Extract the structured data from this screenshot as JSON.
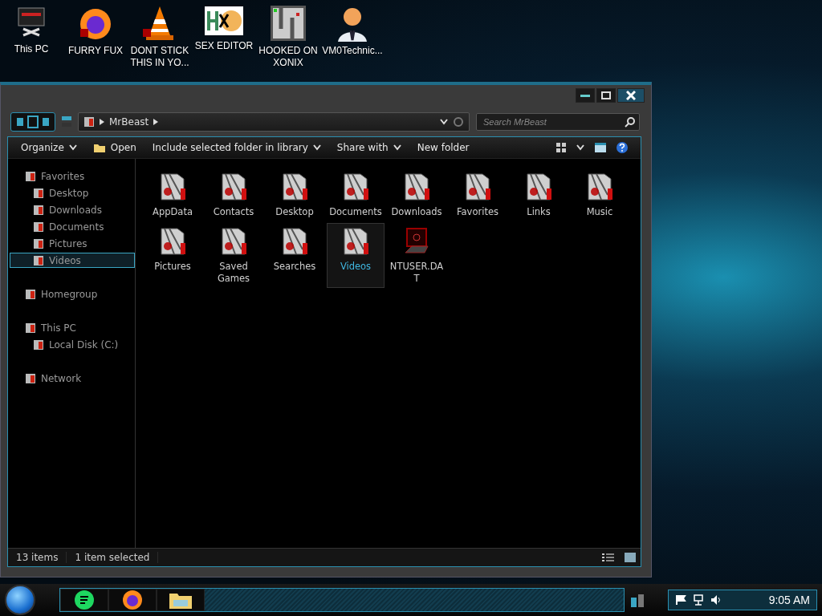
{
  "desktop_icons": [
    {
      "label": "This PC",
      "kind": "pc"
    },
    {
      "label": "FURRY FUX",
      "kind": "browser"
    },
    {
      "label": "DONT STICK THIS IN YO...",
      "kind": "cone"
    },
    {
      "label": "SEX EDITOR",
      "kind": "hex"
    },
    {
      "label": "HOOKED ON XONIX",
      "kind": "game"
    },
    {
      "label": "VM0Technic...",
      "kind": "person"
    }
  ],
  "window": {
    "address": {
      "segments": [
        "MrBeast"
      ]
    },
    "search": {
      "placeholder": "Search MrBeast"
    },
    "commands": [
      {
        "label": "Organize",
        "kind": "menu"
      },
      {
        "label": "Open",
        "kind": "open"
      },
      {
        "label": "Include selected folder in library",
        "kind": "menu"
      },
      {
        "label": "Share with",
        "kind": "menu"
      },
      {
        "label": "New folder",
        "kind": "plain"
      }
    ],
    "nav_pane": [
      {
        "label": "Favorites",
        "selected": false,
        "children": [
          {
            "label": "Desktop",
            "selected": false
          },
          {
            "label": "Downloads",
            "selected": false
          },
          {
            "label": "Documents",
            "selected": false
          },
          {
            "label": "Pictures",
            "selected": false
          },
          {
            "label": "Videos",
            "selected": true
          }
        ]
      },
      {
        "label": "Homegroup",
        "selected": false
      },
      {
        "label": "This PC",
        "selected": false,
        "children": [
          {
            "label": "Local Disk (C:)",
            "selected": false
          }
        ]
      },
      {
        "label": "Network",
        "selected": false
      }
    ],
    "items": [
      {
        "label": "AppData",
        "kind": "folder",
        "selected": false
      },
      {
        "label": "Contacts",
        "kind": "folder",
        "selected": false
      },
      {
        "label": "Desktop",
        "kind": "folder",
        "selected": false
      },
      {
        "label": "Documents",
        "kind": "folder",
        "selected": false
      },
      {
        "label": "Downloads",
        "kind": "folder",
        "selected": false
      },
      {
        "label": "Favorites",
        "kind": "folder",
        "selected": false
      },
      {
        "label": "Links",
        "kind": "folder",
        "selected": false
      },
      {
        "label": "Music",
        "kind": "folder",
        "selected": false
      },
      {
        "label": "Pictures",
        "kind": "folder",
        "selected": false
      },
      {
        "label": "Saved Games",
        "kind": "folder",
        "selected": false
      },
      {
        "label": "Searches",
        "kind": "folder",
        "selected": false
      },
      {
        "label": "Videos",
        "kind": "folder",
        "selected": true
      },
      {
        "label": "NTUSER.DAT",
        "kind": "file",
        "selected": false
      }
    ],
    "status_bar": {
      "count": "13 items",
      "selection": "1 item selected"
    }
  },
  "taskbar": {
    "clock": "9:05 AM"
  }
}
